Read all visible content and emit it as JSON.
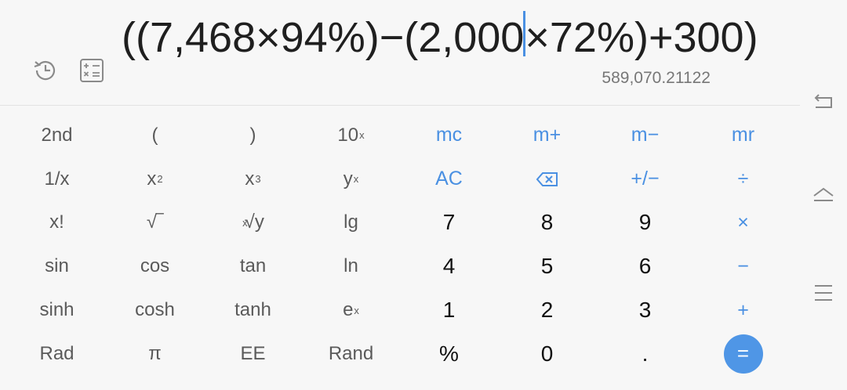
{
  "display": {
    "expression_before_cursor": "((7,468×94%)−(2,000",
    "expression_after_cursor": "×72%)+300)",
    "result": "589,070.21122"
  },
  "toolbar": {
    "history_icon": "history-icon",
    "converter_icon": "unit-converter-icon"
  },
  "keys": {
    "k_2nd": "2nd",
    "k_lparen": "(",
    "k_rparen": ")",
    "k_tenx_base": "10",
    "k_tenx_exp": "x",
    "k_mc": "mc",
    "k_mplus": "m+",
    "k_mminus": "m−",
    "k_mr": "mr",
    "k_inv": "1/x",
    "k_sq_base": "x",
    "k_sq_exp": "2",
    "k_cube_base": "x",
    "k_cube_exp": "3",
    "k_yx_base": "y",
    "k_yx_exp": "x",
    "k_ac": "AC",
    "k_sign": "+/−",
    "k_div": "÷",
    "k_fact": "x!",
    "k_sqrt": "√‾",
    "k_root_idx": "x",
    "k_root_base": "√y",
    "k_lg": "lg",
    "k_7": "7",
    "k_8": "8",
    "k_9": "9",
    "k_mul": "×",
    "k_sin": "sin",
    "k_cos": "cos",
    "k_tan": "tan",
    "k_ln": "ln",
    "k_4": "4",
    "k_5": "5",
    "k_6": "6",
    "k_minus": "−",
    "k_sinh": "sinh",
    "k_cosh": "cosh",
    "k_tanh": "tanh",
    "k_ex_base": "e",
    "k_ex_exp": "x",
    "k_1": "1",
    "k_2": "2",
    "k_3": "3",
    "k_plus": "+",
    "k_rad": "Rad",
    "k_pi": "π",
    "k_ee": "EE",
    "k_rand": "Rand",
    "k_pct": "%",
    "k_0": "0",
    "k_dot": ".",
    "k_eq": "="
  },
  "colors": {
    "accent": "#4a90e2",
    "equals_bg": "#4f96e6",
    "background": "#f7f7f7"
  }
}
